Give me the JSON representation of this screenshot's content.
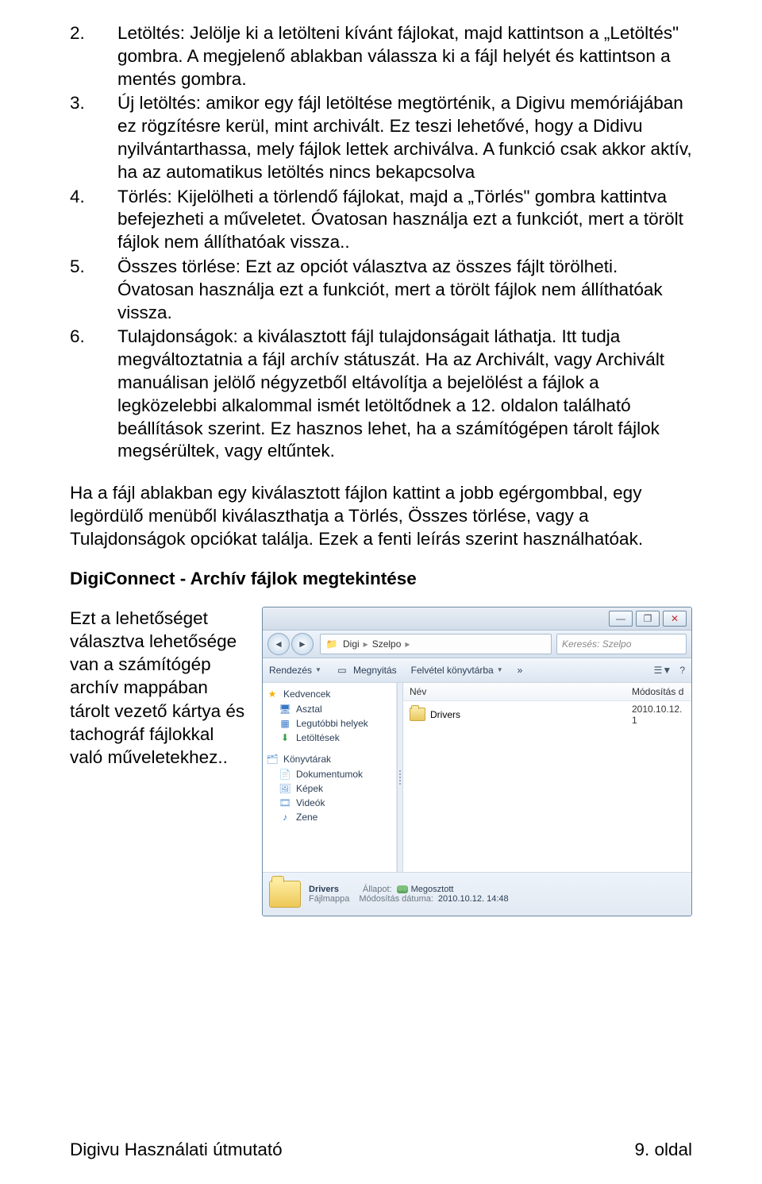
{
  "list": [
    {
      "n": "2.",
      "t": "Letöltés: Jelölje ki a letölteni kívánt fájlokat, majd kattintson a „Letöltés\" gombra. A megjelenő ablakban válassza ki a fájl helyét és kattintson a mentés gombra."
    },
    {
      "n": "3.",
      "t": "Új letöltés: amikor egy fájl letöltése megtörténik, a Digivu memóriájában ez rögzítésre kerül, mint archivált. Ez teszi lehetővé, hogy a Didivu nyilvántarthassa, mely fájlok lettek archiválva. A funkció csak akkor aktív, ha az automatikus letöltés nincs bekapcsolva"
    },
    {
      "n": "4.",
      "t": "Törlés: Kijelölheti a törlendő fájlokat, majd a „Törlés\" gombra kattintva befejezheti a műveletet. Óvatosan használja ezt a funkciót, mert a törölt fájlok nem állíthatóak vissza.."
    },
    {
      "n": "5.",
      "t": "Összes törlése: Ezt az  opciót választva az összes fájlt törölheti. Óvatosan használja ezt a funkciót, mert a törölt fájlok nem állíthatóak vissza."
    },
    {
      "n": "6.",
      "t": "Tulajdonságok: a kiválasztott fájl tulajdonságait láthatja. Itt tudja megváltoztatnia a fájl archív státuszát. Ha az Archivált, vagy Archivált manuálisan jelölő négyzetből eltávolítja a bejelölést a fájlok a legközelebbi alkalommal ismét letöltődnek a 12. oldalon található beállítások szerint. Ez hasznos lehet, ha a számítógépen tárolt fájlok megsérültek, vagy eltűntek."
    }
  ],
  "para": "Ha a fájl ablakban egy kiválasztott fájlon kattint a jobb egérgombbal, egy legördülő menüből kiválaszthatja a Törlés, Összes törlése, vagy a Tulajdonságok opciókat találja. Ezek a fenti leírás szerint használhatóak.",
  "heading": "DigiConnect - Archív fájlok megtekintése",
  "intro": "Ezt a lehetőséget választva lehetősége van a számítógép archív mappában tárolt vezető kártya és tachográf fájlokkal való műveletekhez..",
  "win": {
    "titlebar": {
      "min": "—",
      "max": "❐",
      "close": "✕"
    },
    "nav": {
      "back": "◄",
      "fwd": "►",
      "crumb1": "Digi",
      "crumb2": "Szelpo",
      "searchPlaceholder": "Keresés: Szelpo"
    },
    "toolbar": {
      "rendezes": "Rendezés",
      "megnyitas": "Megnyitás",
      "felvetel": "Felvétel könyvtárba",
      "more": "»",
      "view": "☰",
      "help": "?"
    },
    "side": {
      "fav": "Kedvencek",
      "asztal": "Asztal",
      "legutobbi": "Legutóbbi helyek",
      "letoltesek": "Letöltések",
      "konyvtarak": "Könyvtárak",
      "dokumentumok": "Dokumentumok",
      "kepek": "Képek",
      "videok": "Videók",
      "zene": "Zene"
    },
    "cols": {
      "name": "Név",
      "mod": "Módosítás d"
    },
    "row": {
      "name": "Drivers",
      "date": "2010.10.12. 1"
    },
    "status": {
      "name": "Drivers",
      "allapot_k": "Állapot:",
      "allapot_v": "Megosztott",
      "type_k": "Fájlmappa",
      "mod_k": "Módosítás dátuma:",
      "mod_v": "2010.10.12. 14:48"
    }
  },
  "footer": {
    "left": "Digivu  Használati útmutató",
    "right": "9. oldal"
  }
}
